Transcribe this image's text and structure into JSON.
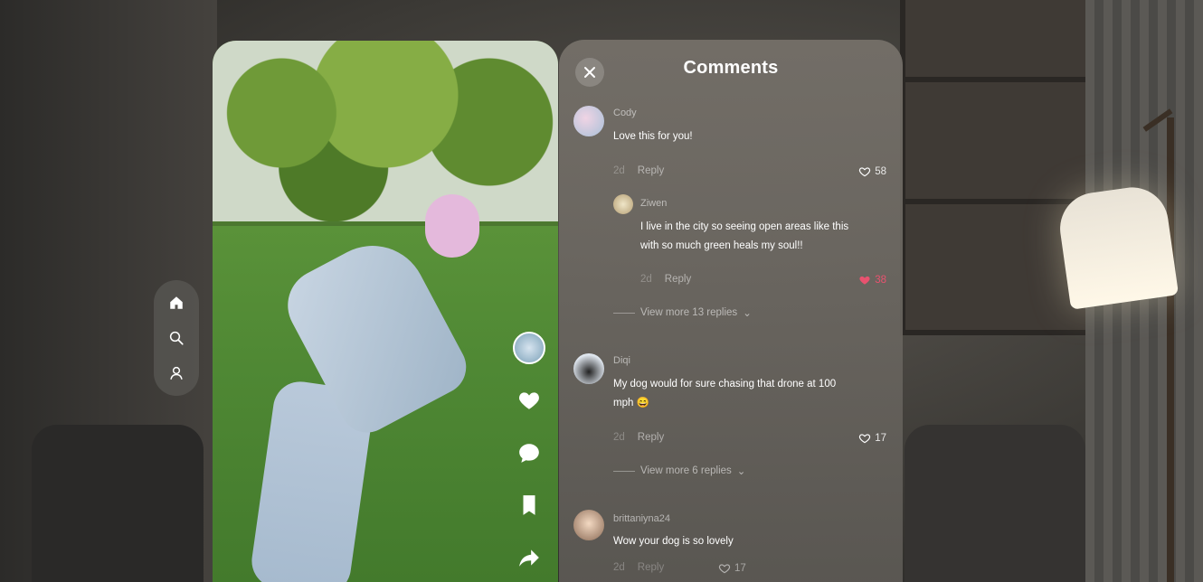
{
  "colors": {
    "like_active": "#e8526f",
    "panel": "#6f6b65"
  },
  "side_nav": [
    {
      "icon": "home-icon"
    },
    {
      "icon": "search-icon"
    },
    {
      "icon": "profile-icon"
    }
  ],
  "comments_panel": {
    "title": "Comments",
    "items": [
      {
        "username": "Cody",
        "text": "Love this for you!",
        "time": "2d",
        "reply_label": "Reply",
        "likes": "58",
        "liked": false,
        "replies": [
          {
            "username": "Ziwen",
            "text_line1": "I live in the city so seeing open areas like this",
            "text_line2": "with so much green heals my soul!!",
            "time": "2d",
            "reply_label": "Reply",
            "likes": "38",
            "liked": true
          }
        ],
        "view_more": "View more 13 replies"
      },
      {
        "username": "Diqi",
        "text_line1": "My dog would for sure chasing that drone at 100",
        "text_line2": "mph 😄",
        "time": "2d",
        "reply_label": "Reply",
        "likes": "17",
        "liked": false,
        "view_more": "View more 6 replies"
      },
      {
        "username": "brittaniyna24",
        "text": "Wow your dog is so lovely",
        "time": "2d",
        "reply_label": "Reply",
        "likes": "17",
        "liked": false
      }
    ]
  }
}
